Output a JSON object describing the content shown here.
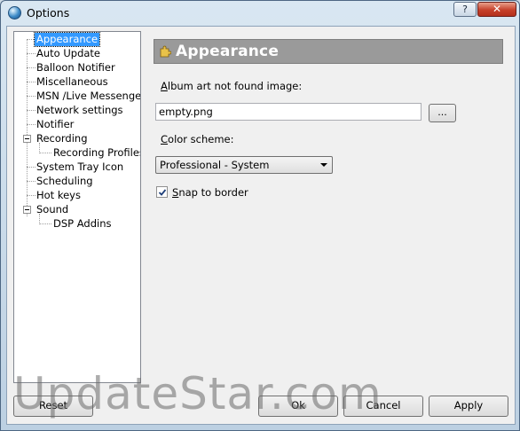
{
  "window": {
    "title": "Options",
    "help_label": "?",
    "close_label": "✕"
  },
  "tree": {
    "items": [
      {
        "label": "Appearance",
        "selected": true
      },
      {
        "label": "Auto Update"
      },
      {
        "label": "Balloon Notifier"
      },
      {
        "label": "Miscellaneous"
      },
      {
        "label": "MSN /Live Messenger"
      },
      {
        "label": "Network settings"
      },
      {
        "label": "Notifier"
      },
      {
        "label": "Recording",
        "expanded": true
      },
      {
        "label": "Recording Profiles"
      },
      {
        "label": "System Tray Icon"
      },
      {
        "label": "Scheduling"
      },
      {
        "label": "Hot keys"
      },
      {
        "label": "Sound",
        "expanded": true
      },
      {
        "label": "DSP Addins"
      }
    ]
  },
  "panel": {
    "title": "Appearance",
    "album_art_label_ul": "A",
    "album_art_label_rest": "lbum art not found image:",
    "album_art_value": "empty.png",
    "browse_label": "...",
    "color_scheme_label_ul": "C",
    "color_scheme_label_rest": "olor scheme:",
    "color_scheme_value": "Professional - System",
    "snap_label_ul": "S",
    "snap_label_rest": "nap to border",
    "snap_checked": true
  },
  "buttons": {
    "reset": "Reset",
    "ok": "Ok",
    "cancel": "Cancel",
    "apply": "Apply"
  },
  "watermark": "UpdateStar.com"
}
